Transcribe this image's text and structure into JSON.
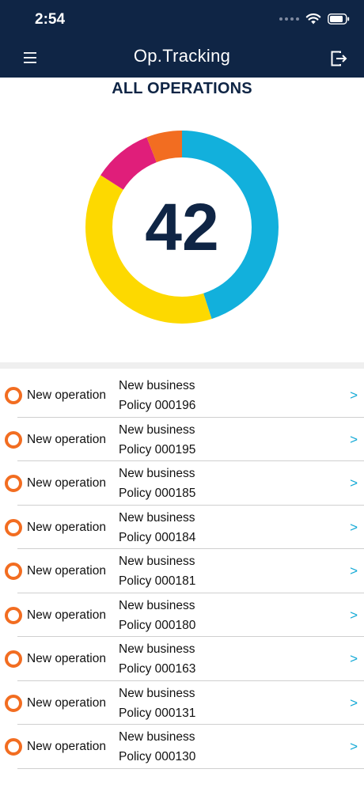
{
  "status_bar": {
    "time": "2:54"
  },
  "header": {
    "title": "Op.Tracking"
  },
  "section_title": "ALL OPERATIONS",
  "summary": {
    "total": "42",
    "segments": [
      {
        "color": "#12b0dc",
        "fraction": 0.45
      },
      {
        "color": "#fdd900",
        "fraction": 0.39
      },
      {
        "color": "#e01e7a",
        "fraction": 0.1
      },
      {
        "color": "#f26d21",
        "fraction": 0.06
      }
    ]
  },
  "colors": {
    "header_bg": "#0f2545",
    "accent": "#12a9d6",
    "status_ring": "#f26d21"
  },
  "operations": [
    {
      "type": "New operation",
      "category": "New business",
      "policy": "Policy 000196"
    },
    {
      "type": "New operation",
      "category": "New business",
      "policy": "Policy 000195"
    },
    {
      "type": "New operation",
      "category": "New business",
      "policy": "Policy 000185"
    },
    {
      "type": "New operation",
      "category": "New business",
      "policy": "Policy 000184"
    },
    {
      "type": "New operation",
      "category": "New business",
      "policy": "Policy 000181"
    },
    {
      "type": "New operation",
      "category": "New business",
      "policy": "Policy 000180"
    },
    {
      "type": "New operation",
      "category": "New business",
      "policy": "Policy 000163"
    },
    {
      "type": "New operation",
      "category": "New business",
      "policy": "Policy 000131"
    },
    {
      "type": "New operation",
      "category": "New business",
      "policy": "Policy 000130"
    }
  ],
  "row_chevron": ">"
}
